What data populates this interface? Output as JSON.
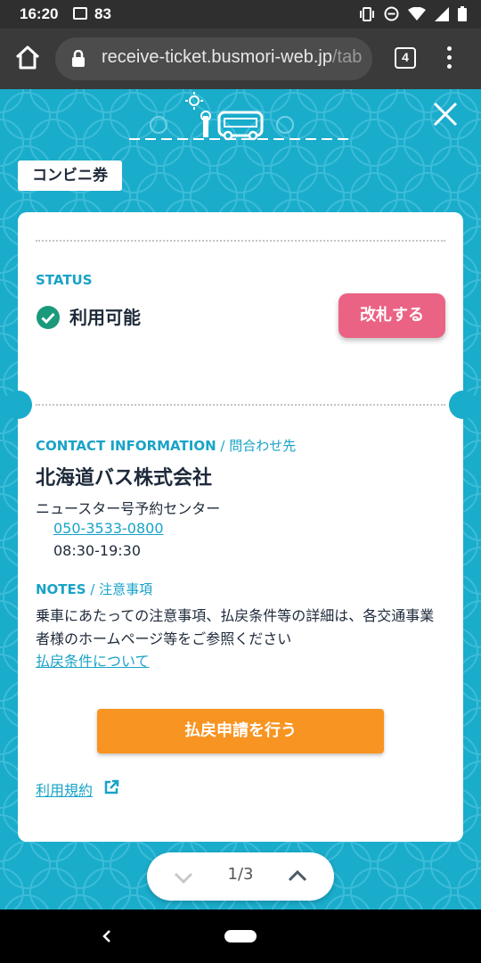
{
  "status_bar": {
    "time": "16:20",
    "notification_count": "83"
  },
  "browser": {
    "url_main": "receive-ticket.busmori-web.jp",
    "url_rest": "/tab",
    "tab_count": "4"
  },
  "page": {
    "ticket_type": "コンビニ券",
    "status": {
      "label": "STATUS",
      "value": "利用可能",
      "button_label": "改札する"
    },
    "contact": {
      "label": "CONTACT INFORMATION",
      "label_jp": " / 問合わせ先",
      "company": "北海道バス株式会社",
      "center": "ニュースター号予約センター",
      "phone": "050-3533-0800",
      "hours": "08:30-19:30"
    },
    "notes": {
      "label": "NOTES",
      "label_jp": " / 注意事項",
      "text": "乗車にあたっての注意事項、払戻条件等の詳細は、各交通事業者様のホームページ等をご参照ください",
      "refund_link": "払戻条件について"
    },
    "refund_button": "払戻申請を行う",
    "terms_link": "利用規約",
    "pager": {
      "count": "1/3"
    }
  },
  "colors": {
    "teal": "#1aaccb",
    "label_blue": "#19a3c7",
    "pink": "#ea6384",
    "orange": "#f89421",
    "check_green": "#1a9a7a"
  }
}
